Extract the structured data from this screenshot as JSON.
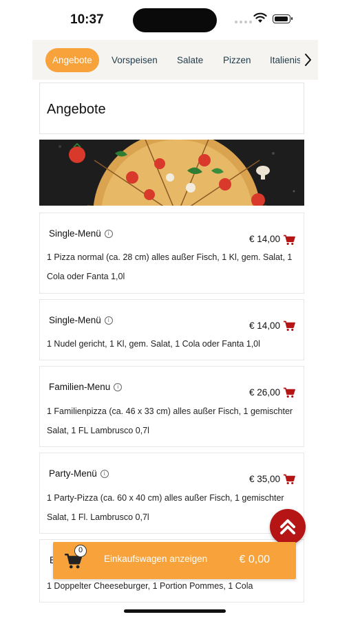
{
  "status_bar": {
    "time": "10:37"
  },
  "categories": [
    {
      "label": "Angebote",
      "active": true
    },
    {
      "label": "Vorspeisen",
      "active": false
    },
    {
      "label": "Salate",
      "active": false
    },
    {
      "label": "Pizzen",
      "active": false
    },
    {
      "label": "Italienis",
      "active": false
    }
  ],
  "section": {
    "title": "Angebote"
  },
  "items": [
    {
      "name": "Single-Menü",
      "price": "€ 14,00",
      "description": "1 Pizza normal (ca. 28 cm) alles außer Fisch, 1 Kl, gem. Salat, 1 Cola oder Fanta 1,0l"
    },
    {
      "name": "Single-Menü",
      "price": "€ 14,00",
      "description": "1 Nudel gericht, 1 Kl, gem. Salat, 1 Cola oder Fanta 1,0l"
    },
    {
      "name": "Familien-Menu",
      "price": "€ 26,00",
      "description": "1 Familienpizza (ca. 46 x 33 cm) alles außer Fisch, 1 gemischter Salat, 1 FL Lambrusco 0,7l"
    },
    {
      "name": "Party-Menü",
      "price": "€ 35,00",
      "description": "1 Party-Pizza (ca. 60 x 40 cm) alles außer Fisch, 1 gemischter Salat, 1 Fl. Lambrusco 0,7l"
    },
    {
      "name": "B",
      "price": "",
      "description": "1 Doppelter Cheeseburger, 1 Portion Pommes, 1 Cola"
    }
  ],
  "cart_bar": {
    "count": "0",
    "label": "Einkaufswagen anzeigen",
    "total": "€ 0,00"
  },
  "colors": {
    "accent": "#f7a23a",
    "cart_red": "#b51515",
    "nav_bg": "#f6f4f1"
  }
}
